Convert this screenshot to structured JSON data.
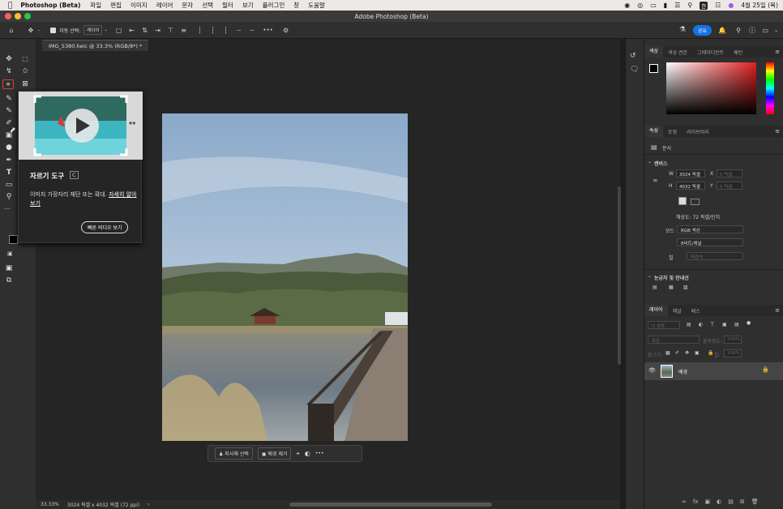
{
  "menubar": {
    "app_name": "Photoshop (Beta)",
    "items": [
      "파일",
      "편집",
      "이미지",
      "레이어",
      "문자",
      "선택",
      "필터",
      "보기",
      "플러그인",
      "창",
      "도움말"
    ],
    "date": "4월 25일 (목)",
    "ime": "한"
  },
  "window": {
    "title": "Adobe Photoshop (Beta)"
  },
  "options": {
    "auto_select_label": "자동 선택:",
    "auto_select_value": "레이어",
    "more": "•••",
    "share_label": "공유"
  },
  "document": {
    "tab_label": "IMG_5380.heic @ 33.3% (RGB/8*) *"
  },
  "status": {
    "zoom": "33.33%",
    "info": "3024 픽셀 x 4032 픽셀 (72 ppi)"
  },
  "context_bar": {
    "select_subject": "피사체 선택",
    "remove_bg": "배경 제거",
    "more": "•••"
  },
  "tooltip": {
    "title": "자르기 도구",
    "shortcut": "C",
    "desc_prefix": "이미지 가장자리 재단 또는 확대.",
    "learn_more": "자세히 알아보기",
    "button": "빠른 비디오 보기"
  },
  "color_panel": {
    "tabs": [
      "색상",
      "색상 견본",
      "그레이디언트",
      "패턴"
    ],
    "active": 0
  },
  "properties": {
    "tabs": [
      "속성",
      "조정",
      "라이브러리"
    ],
    "doc_label": "문서",
    "canvas_section": "캔버스",
    "w_label": "W",
    "w_value": "3024 픽셀",
    "h_label": "H",
    "h_value": "4032 픽셀",
    "x_label": "X",
    "x_placeholder": "0 픽셀",
    "y_label": "Y",
    "y_placeholder": "0 픽셀",
    "resolution": "해상도: 72 픽셀/인치",
    "mode_label": "모드",
    "mode_value": "RGB 색상",
    "depth_value": "8비트/채널",
    "bg_label": "칠",
    "bg_value": "배경색",
    "rulers_section": "눈금자 및 안내선"
  },
  "layers_panel": {
    "tabs": [
      "레이어",
      "채널",
      "패스"
    ],
    "kind_label": "Q 종류",
    "blend_mode": "표준",
    "opacity_label": "불투명도:",
    "opacity_value": "100%",
    "lock_label": "잠그기:",
    "fill_label": "칠:",
    "fill_value": "100%",
    "layer_name": "배경"
  },
  "colors": {
    "accent": "#1473e6",
    "highlight": "#e03b3b"
  }
}
